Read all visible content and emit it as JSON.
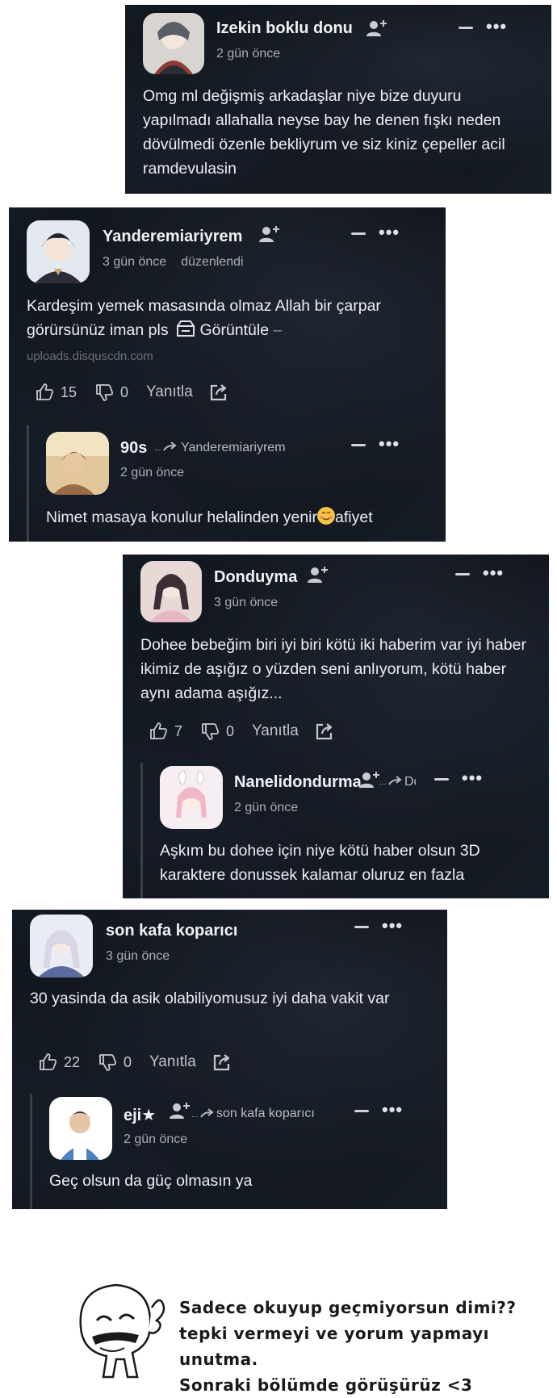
{
  "comments": [
    {
      "username": "Izekin boklu donu",
      "time": "2 gün önce",
      "text": "Omg ml değişmiş arkadaşlar niye bize duyuru yapılmadı allahalla neyse bay he denen fışkı neden dövülmedi özenle bekliyrum ve siz kiniz çepeller acil ramdevulasin"
    },
    {
      "username": "Yanderemiariyrem",
      "time": "3 gün önce",
      "edited": "düzenlendi",
      "text": "Kardeşim yemek masasında olmaz Allah bir çarpar görürsünüz iman pls",
      "view_label": "Görüntüle",
      "link_dash": "–",
      "url": "uploads.disquscdn.com",
      "likes": "15",
      "dislikes": "0",
      "reply_label": "Yanıtla",
      "reply": {
        "username": "90s",
        "reply_to": "Yanderemiariyrem",
        "time": "2 gün önce",
        "text": "Nimet masaya konulur helalinden yenir",
        "text_after": "afiyet"
      }
    },
    {
      "username": "Donduyma",
      "time": "3 gün önce",
      "text": "Dohee bebeğim biri iyi biri kötü iki haberim var iyi haber ikimiz de aşığız o yüzden seni anlıyorum, kötü haber aynı adama aşığız...",
      "likes": "7",
      "dislikes": "0",
      "reply_label": "Yanıtla",
      "reply": {
        "username": "Nanelidondurma",
        "reply_to": "Dc",
        "time": "2 gün önce",
        "text": "Aşkım bu dohee için niye kötü haber olsun 3D karaktere donussek kalamar oluruz en fazla"
      }
    },
    {
      "username": "son kafa koparıcı",
      "time": "3 gün önce",
      "text": "30 yasinda da asik olabiliyomusuz iyi daha vakit var",
      "likes": "22",
      "dislikes": "0",
      "reply_label": "Yanıtla",
      "reply": {
        "username": "eji★",
        "reply_to": "son kafa koparıcı",
        "time": "2 gün önce",
        "text": "Geç olsun da güç olmasın ya"
      }
    }
  ],
  "footer": {
    "lines": [
      "Sadece okuyup geçmiyorsun dimi??",
      "tepki vermeyi ve yorum yapmayı unutma.",
      "Sonraki bölümde görüşürüz <3"
    ]
  },
  "colors": {
    "card_bg": "#0b0f15",
    "username": "#f0f1f3",
    "meta": "#a9adb5",
    "text": "#eceef0"
  }
}
